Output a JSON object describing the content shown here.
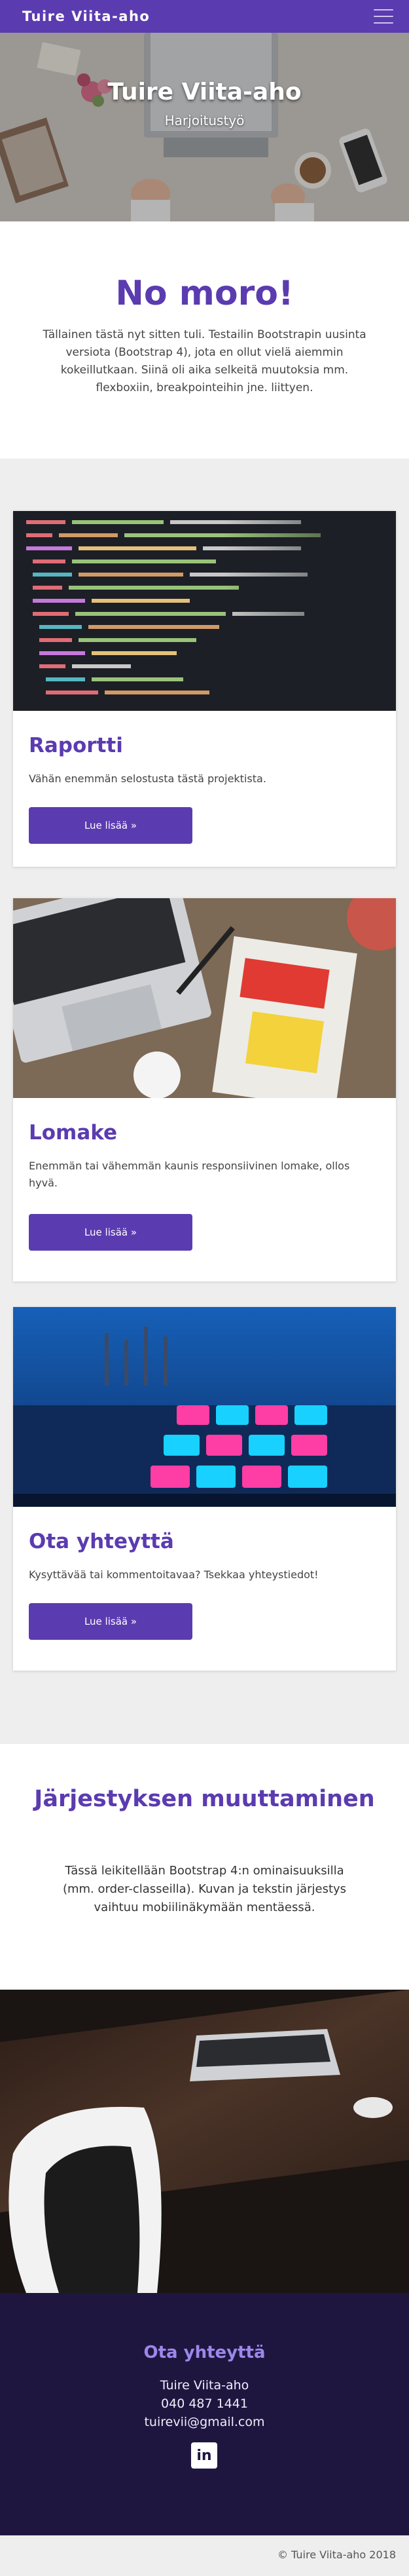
{
  "navbar": {
    "brand": "Tuire Viita-aho",
    "menu_icon": "hamburger-menu-icon",
    "color": "#5b3bb0"
  },
  "hero": {
    "title": "Tuire Viita-aho",
    "subtitle": "Harjoitustyö"
  },
  "intro": {
    "heading": "No moro!",
    "text": "Tällainen tästä nyt sitten tuli. Testailin Bootstrapin uusinta versiota (Bootstrap 4), jota en ollut vielä aiemmin kokeillutkaan. Siinä oli aika selkeitä muutoksia mm. flexboxiin, breakpointeihin jne. liittyen."
  },
  "cards": [
    {
      "title": "Raportti",
      "text": "Vähän enemmän selostusta tästä projektista.",
      "button": "Lue lisää »",
      "image": "code-editor-photo"
    },
    {
      "title": "Lomake",
      "text": "Enemmän tai vähemmän kaunis responsiivinen lomake, ollos hyvä.",
      "button": "Lue lisää »",
      "image": "laptop-book-photo"
    },
    {
      "title": "Ota yhteyttä",
      "text": "Kysyttävää tai kommentoitavaa? Tsekkaa yhteystiedot!",
      "button": "Lue lisää »",
      "image": "midi-controller-photo"
    }
  ],
  "order_section": {
    "heading": "Järjestyksen muuttaminen",
    "text": "Tässä leikitellään Bootstrap 4:n ominaisuuksilla (mm. order-classeilla). Kuvan ja tekstin järjestys vaihtuu mobiilinäkymään mentäessä."
  },
  "contact": {
    "heading": "Ota yhteyttä",
    "name": "Tuire Viita-aho",
    "phone": "040 487 1441",
    "email": "tuirevii@gmail.com",
    "linkedin_icon": "linkedin-icon"
  },
  "footer": {
    "copyright": "© Tuire Viita-aho 2018"
  }
}
